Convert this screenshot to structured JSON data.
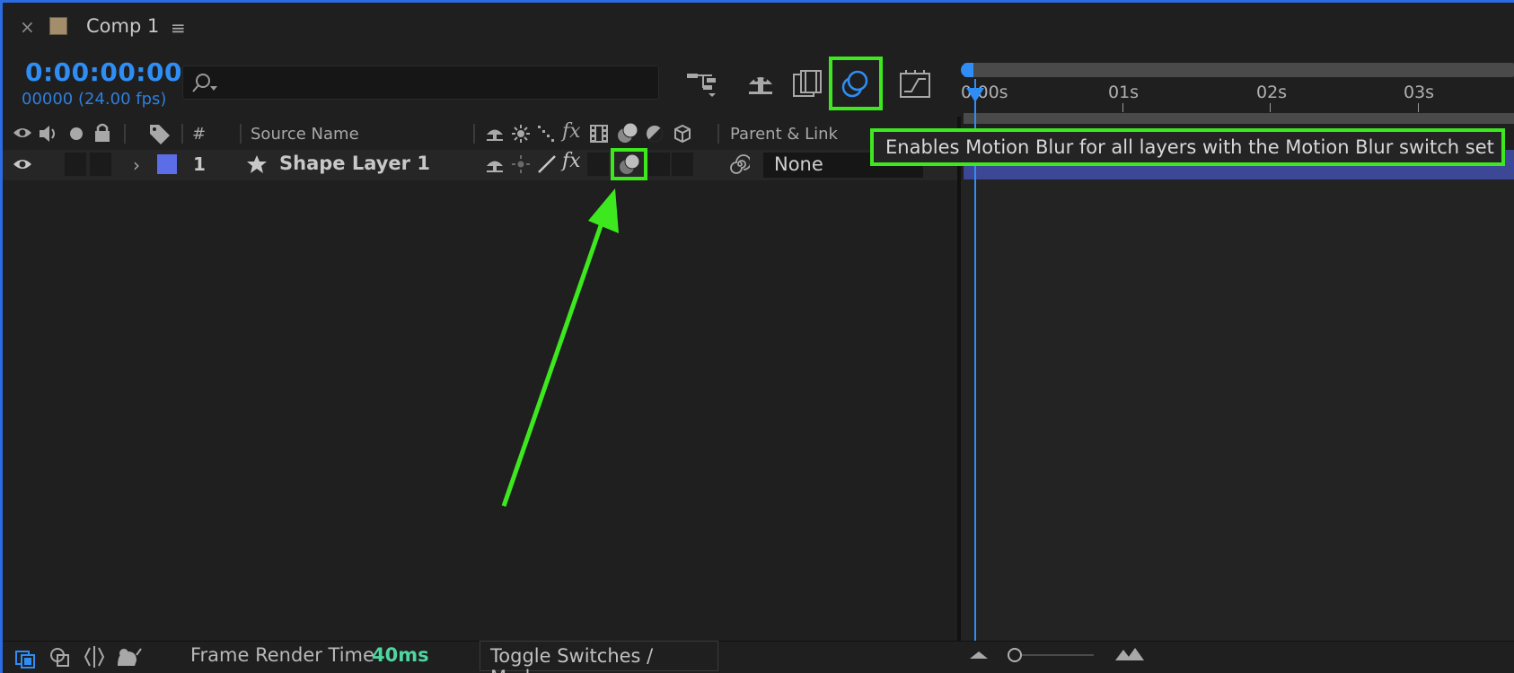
{
  "tab": {
    "close": "×",
    "title": "Comp 1",
    "menu": "≡"
  },
  "timecode": {
    "value": "0:00:00:00",
    "frames": "00000 (24.00 fps)"
  },
  "search": {
    "placeholder": ""
  },
  "toolbar_icons": [
    "draft-3d-icon",
    "shy-layers-icon",
    "frame-blending-icon",
    "motion-blur-icon",
    "graph-editor-icon"
  ],
  "ruler": {
    "ticks": [
      "0:00s",
      "01s",
      "02s",
      "03s"
    ]
  },
  "columns": {
    "num": "#",
    "source_name": "Source Name",
    "parent_link": "Parent & Link"
  },
  "layer": {
    "index": "1",
    "name": "Shape Layer 1",
    "parent": "None",
    "color": "#5b6ee8"
  },
  "tooltip": {
    "text": "Enables Motion Blur for all layers with the Motion Blur switch set"
  },
  "status": {
    "label": "Frame Render Time",
    "value": "40ms",
    "toggle": "Toggle Switches / Modes"
  },
  "colors": {
    "accent": "#2f8ef5",
    "highlight": "#3ee81f",
    "render_time": "#4fd6a0"
  }
}
